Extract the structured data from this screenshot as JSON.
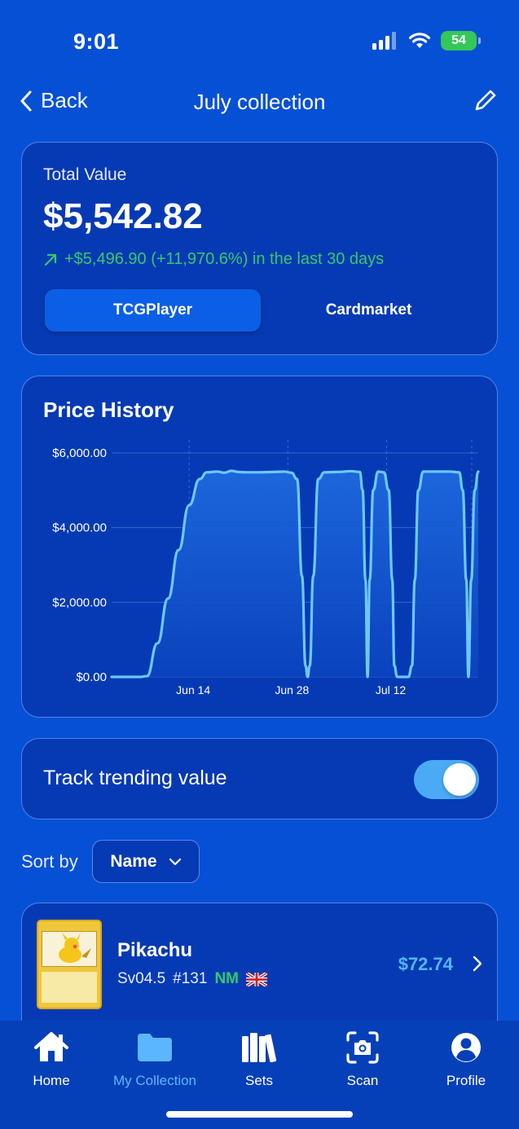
{
  "status_bar": {
    "time": "9:01",
    "battery": "54"
  },
  "nav": {
    "back_label": "Back",
    "title": "July collection"
  },
  "summary": {
    "total_label": "Total Value",
    "total_value": "$5,542.82",
    "change": "+$5,496.90 (+11,970.6%) in the last 30 days",
    "tabs": [
      "TCGPlayer",
      "Cardmarket"
    ],
    "active_tab": "TCGPlayer"
  },
  "chart_data": {
    "type": "area",
    "title": "Price History",
    "xlabel": "",
    "ylabel": "",
    "y_ticks": [
      "$6,000.00",
      "$4,000.00",
      "$2,000.00",
      "$0.00"
    ],
    "ylim": [
      0,
      6000
    ],
    "x_ticks": [
      "Jun 14",
      "Jun 28",
      "Jul 12"
    ],
    "x_range_days": [
      0,
      52
    ],
    "x_tick_days": [
      11,
      25,
      39
    ],
    "grid": true,
    "colors": {
      "line": "#6cc8ff",
      "fill_top": "#1f6be0",
      "fill_bottom": "#0a43bd"
    },
    "points": [
      [
        0,
        0
      ],
      [
        4,
        0
      ],
      [
        5,
        20
      ],
      [
        6.5,
        900
      ],
      [
        8,
        2100
      ],
      [
        9.5,
        3400
      ],
      [
        11,
        4600
      ],
      [
        12.5,
        5300
      ],
      [
        13.5,
        5480
      ],
      [
        15,
        5500
      ],
      [
        16,
        5470
      ],
      [
        17,
        5520
      ],
      [
        18,
        5490
      ],
      [
        19,
        5480
      ],
      [
        21,
        5480
      ],
      [
        23,
        5490
      ],
      [
        24.5,
        5500
      ],
      [
        25.5,
        5470
      ],
      [
        26.3,
        5300
      ],
      [
        27,
        2700
      ],
      [
        27.5,
        300
      ],
      [
        27.8,
        0
      ],
      [
        28.1,
        300
      ],
      [
        28.6,
        2700
      ],
      [
        29.3,
        5300
      ],
      [
        30.2,
        5480
      ],
      [
        32,
        5490
      ],
      [
        34,
        5510
      ],
      [
        35.2,
        5490
      ],
      [
        35.6,
        5000
      ],
      [
        36.0,
        2600
      ],
      [
        36.3,
        0
      ],
      [
        36.6,
        2600
      ],
      [
        37.1,
        5000
      ],
      [
        37.8,
        5500
      ],
      [
        38.6,
        5480
      ],
      [
        39.3,
        5000
      ],
      [
        39.8,
        2600
      ],
      [
        40.1,
        300
      ],
      [
        40.5,
        0
      ],
      [
        42.1,
        0
      ],
      [
        42.6,
        300
      ],
      [
        43.0,
        2600
      ],
      [
        43.5,
        5000
      ],
      [
        44.2,
        5500
      ],
      [
        46,
        5500
      ],
      [
        48,
        5500
      ],
      [
        49.3,
        5480
      ],
      [
        49.8,
        5000
      ],
      [
        50.3,
        2600
      ],
      [
        50.6,
        0
      ],
      [
        51.0,
        2600
      ],
      [
        51.5,
        5000
      ],
      [
        52,
        5500
      ]
    ]
  },
  "toggle": {
    "label": "Track trending value",
    "on": true
  },
  "sort": {
    "label": "Sort by",
    "value": "Name"
  },
  "cards": [
    {
      "name": "Pikachu",
      "set": "Sv04.5",
      "number": "#131",
      "condition": "NM",
      "price": "$72.74"
    }
  ],
  "tabbar": {
    "items": [
      {
        "label": "Home",
        "icon": "house-icon"
      },
      {
        "label": "My Collection",
        "icon": "folder-icon"
      },
      {
        "label": "Sets",
        "icon": "books-icon"
      },
      {
        "label": "Scan",
        "icon": "camera-scan-icon"
      },
      {
        "label": "Profile",
        "icon": "person-circle-icon"
      }
    ],
    "active": "My Collection"
  }
}
